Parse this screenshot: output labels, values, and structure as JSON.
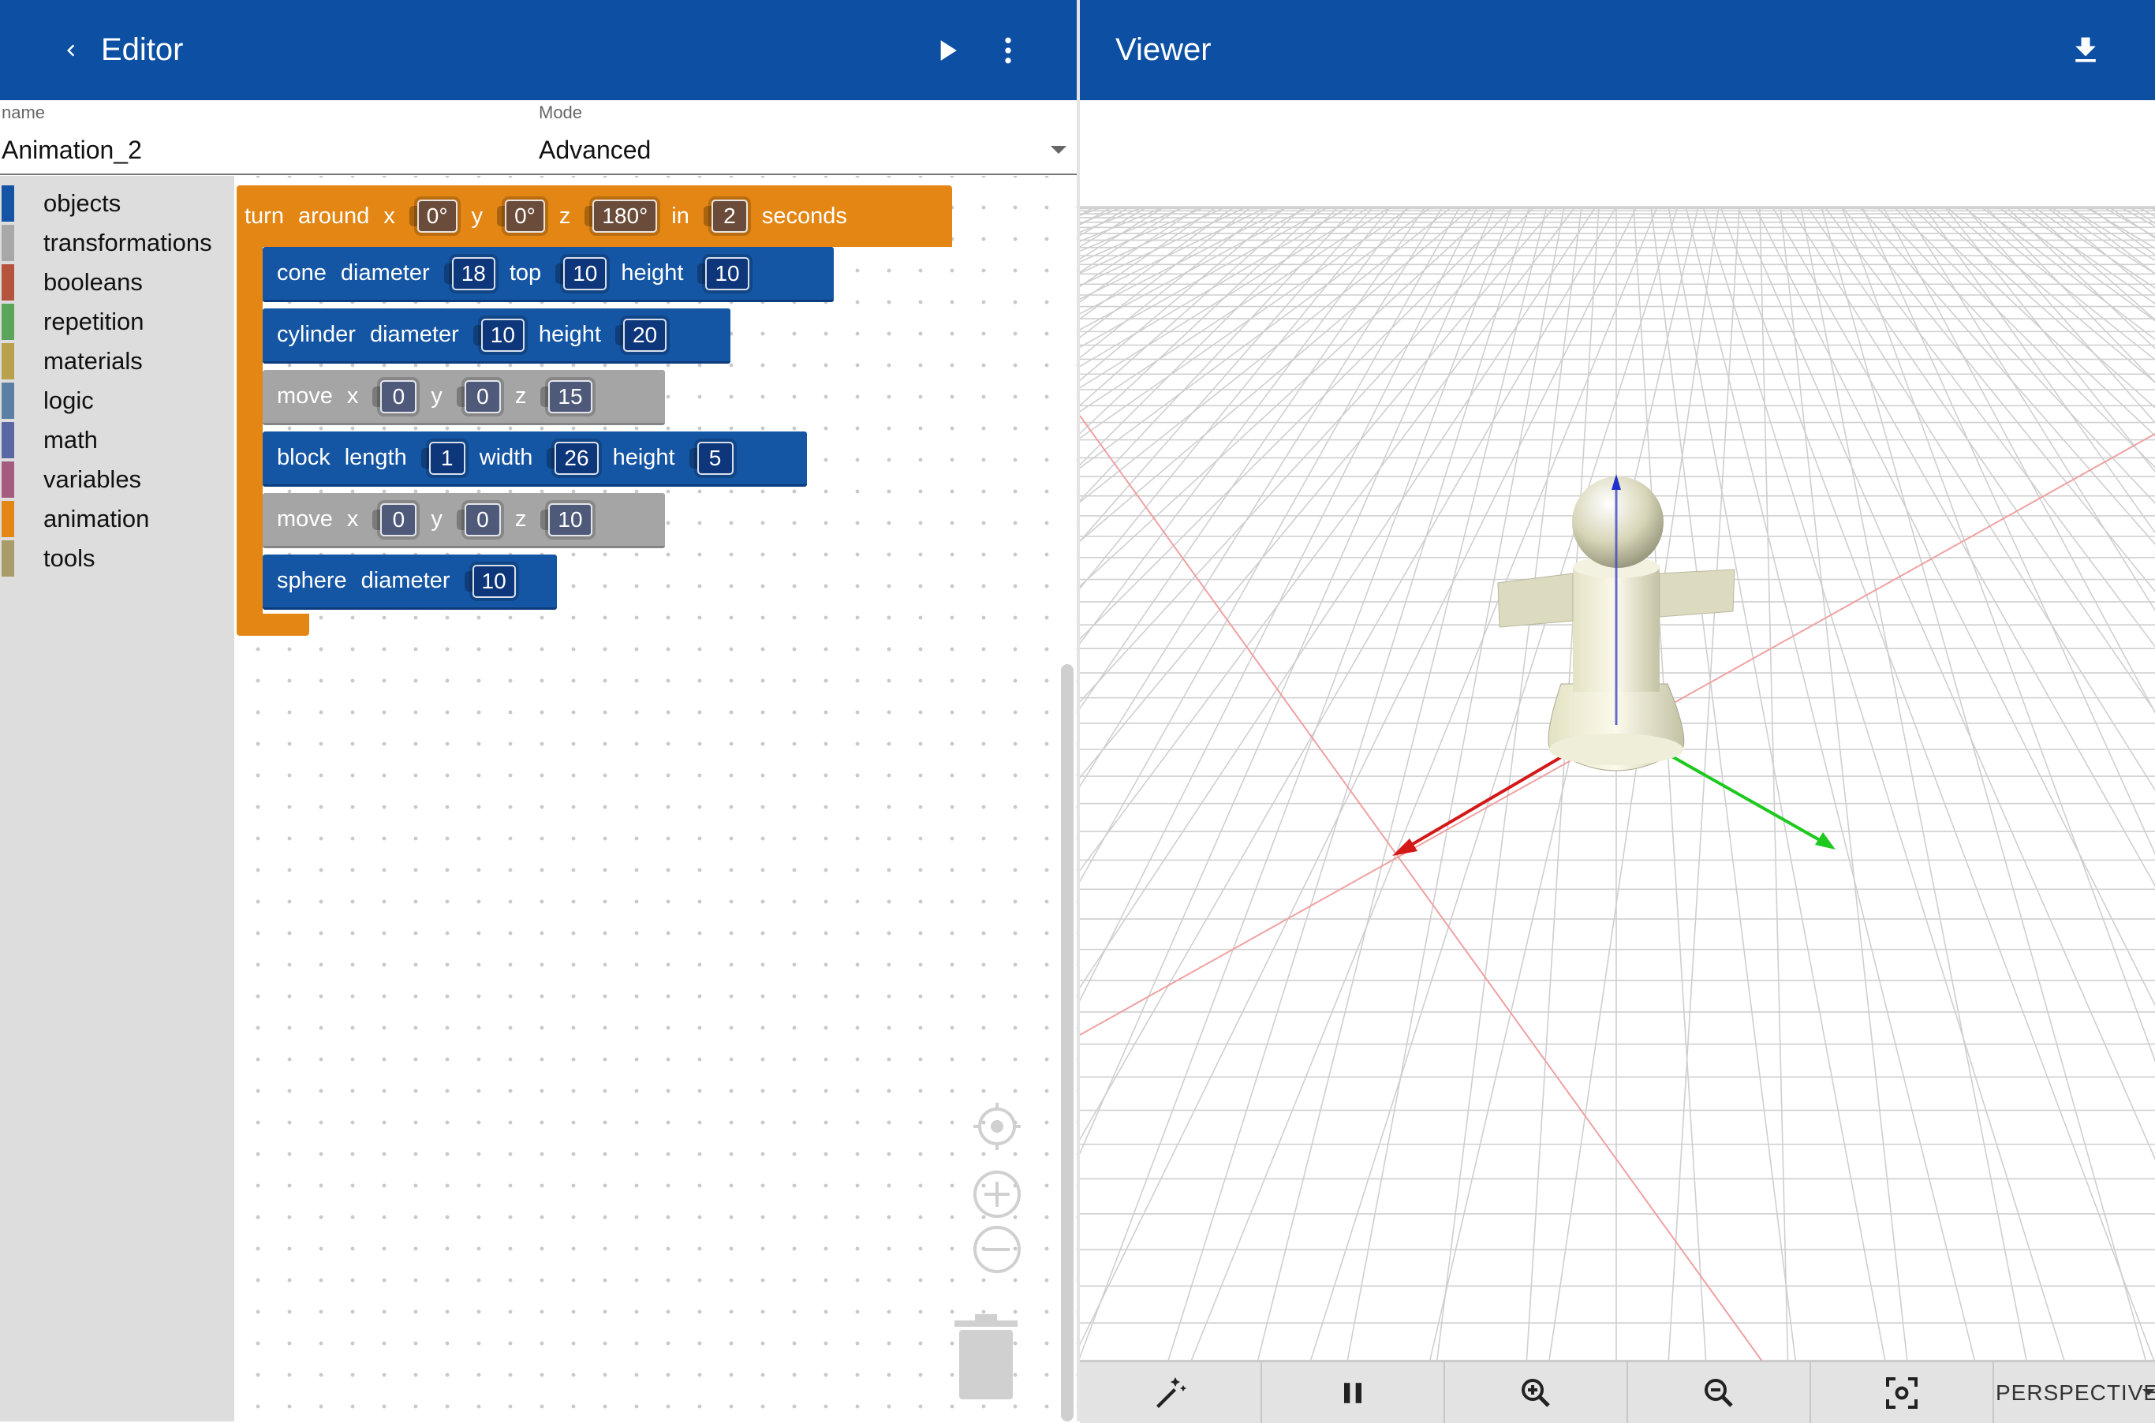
{
  "editor": {
    "title": "Editor",
    "name_label": "name",
    "name_value": "Animation_2",
    "mode_label": "Mode",
    "mode_value": "Advanced"
  },
  "viewer": {
    "title": "Viewer",
    "camera_mode": "PERSPECTIVE"
  },
  "icons": {
    "back": "chevron-left-icon",
    "run": "play-icon",
    "menu": "more-vert-icon",
    "download": "download-icon",
    "center": "crosshair-icon",
    "zoom_in": "plus-circle-icon",
    "zoom_out": "minus-circle-icon",
    "trash": "trash-icon",
    "magic": "magic-wand-icon",
    "pause": "pause-icon",
    "viewer_zoom_in": "zoom-in-icon",
    "viewer_zoom_out": "zoom-out-icon",
    "fit": "fit-view-icon"
  },
  "toolbox": [
    {
      "label": "objects",
      "color": "#1553a5"
    },
    {
      "label": "transformations",
      "color": "#a8a8a8"
    },
    {
      "label": "booleans",
      "color": "#b5533c"
    },
    {
      "label": "repetition",
      "color": "#5ba55b"
    },
    {
      "label": "materials",
      "color": "#b8a14c"
    },
    {
      "label": "logic",
      "color": "#5b80a5"
    },
    {
      "label": "math",
      "color": "#5b67a5"
    },
    {
      "label": "variables",
      "color": "#a55b80"
    },
    {
      "label": "animation",
      "color": "#e38614"
    },
    {
      "label": "tools",
      "color": "#a89d6a"
    }
  ],
  "blocks": {
    "turn": {
      "w1": "turn",
      "w2": "around",
      "x_label": "x",
      "x": "0°",
      "y_label": "y",
      "y": "0°",
      "z_label": "z",
      "z": "180°",
      "in_label": "in",
      "time": "2",
      "unit": "seconds"
    },
    "cone": {
      "w1": "cone",
      "w2": "diameter",
      "diameter": "18",
      "top_label": "top",
      "top": "10",
      "height_label": "height",
      "height": "10"
    },
    "cylinder": {
      "w1": "cylinder",
      "w2": "diameter",
      "diameter": "10",
      "height_label": "height",
      "height": "20"
    },
    "move1": {
      "w1": "move",
      "x_label": "x",
      "x": "0",
      "y_label": "y",
      "y": "0",
      "z_label": "z",
      "z": "15"
    },
    "block": {
      "w1": "block",
      "w2": "length",
      "length": "1",
      "width_label": "width",
      "width": "26",
      "height_label": "height",
      "height": "5"
    },
    "move2": {
      "w1": "move",
      "x_label": "x",
      "x": "0",
      "y_label": "y",
      "y": "0",
      "z_label": "z",
      "z": "10"
    },
    "sphere": {
      "w1": "sphere",
      "w2": "diameter",
      "diameter": "10"
    }
  },
  "colors": {
    "app_bar": "#0d4fa3",
    "objects_block": "#1455a4",
    "transform_block": "#a5a5a5",
    "animation_block": "#e38614"
  }
}
